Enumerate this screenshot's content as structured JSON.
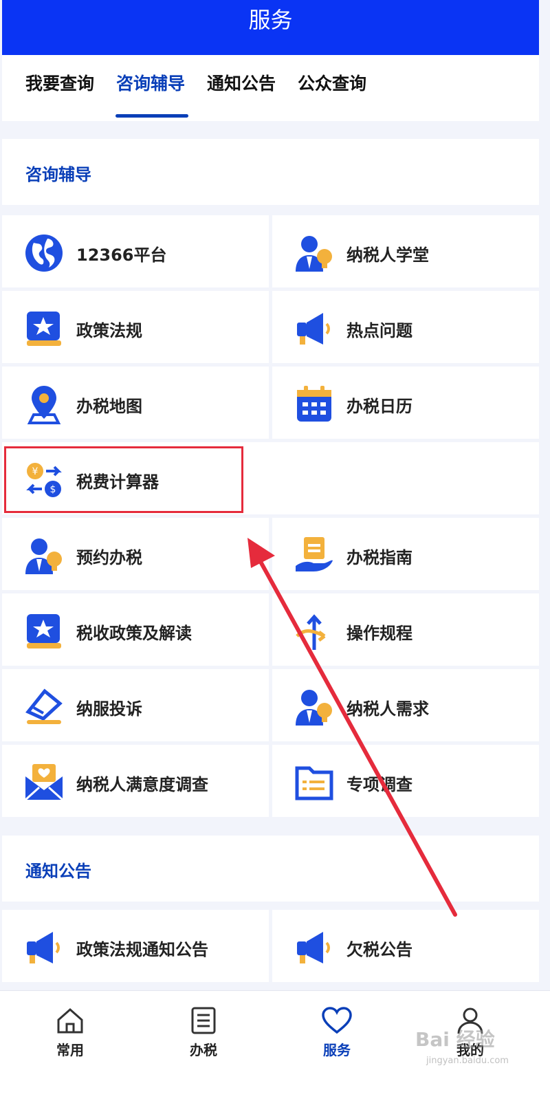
{
  "header": {
    "title": "服务"
  },
  "tabs": [
    {
      "label": "我要查询"
    },
    {
      "label": "咨询辅导"
    },
    {
      "label": "通知公告"
    },
    {
      "label": "公众查询"
    }
  ],
  "sections": [
    {
      "title": "咨询辅导",
      "items": [
        {
          "label": "12366平台",
          "icon": "globe-icon"
        },
        {
          "label": "纳税人学堂",
          "icon": "person-bulb-icon"
        },
        {
          "label": "政策法规",
          "icon": "star-book-icon"
        },
        {
          "label": "热点问题",
          "icon": "megaphone-icon"
        },
        {
          "label": "办税地图",
          "icon": "map-pin-icon"
        },
        {
          "label": "办税日历",
          "icon": "calendar-icon"
        },
        {
          "label": "税费计算器",
          "icon": "currency-exchange-icon"
        },
        {
          "label": "预约办税",
          "icon": "person-bulb-icon"
        },
        {
          "label": "办税指南",
          "icon": "hand-document-icon"
        },
        {
          "label": "税收政策及解读",
          "icon": "star-book-icon"
        },
        {
          "label": "操作规程",
          "icon": "split-arrows-icon"
        },
        {
          "label": "纳服投诉",
          "icon": "envelope-complaint-icon"
        },
        {
          "label": "纳税人需求",
          "icon": "person-bulb-icon"
        },
        {
          "label": "纳税人满意度调查",
          "icon": "heart-mail-icon"
        },
        {
          "label": "专项调查",
          "icon": "folder-list-icon"
        }
      ]
    },
    {
      "title": "通知公告",
      "items": [
        {
          "label": "政策法规通知公告",
          "icon": "megaphone-icon"
        },
        {
          "label": "欠税公告",
          "icon": "megaphone-icon"
        }
      ]
    }
  ],
  "bottom_nav": [
    {
      "label": "常用",
      "icon": "home-icon"
    },
    {
      "label": "办税",
      "icon": "list-icon"
    },
    {
      "label": "服务",
      "icon": "heart-icon",
      "active": true
    },
    {
      "label": "我的",
      "icon": "user-icon"
    }
  ],
  "watermark": {
    "text": "Bai 经验",
    "sub": "jingyan.baidu.com"
  },
  "colors": {
    "brand": "#0a34f4",
    "accent": "#0a3fb8",
    "highlight": "#e52b3c",
    "icon_blue": "#1f4fe0",
    "icon_yellow": "#f3b13c"
  }
}
